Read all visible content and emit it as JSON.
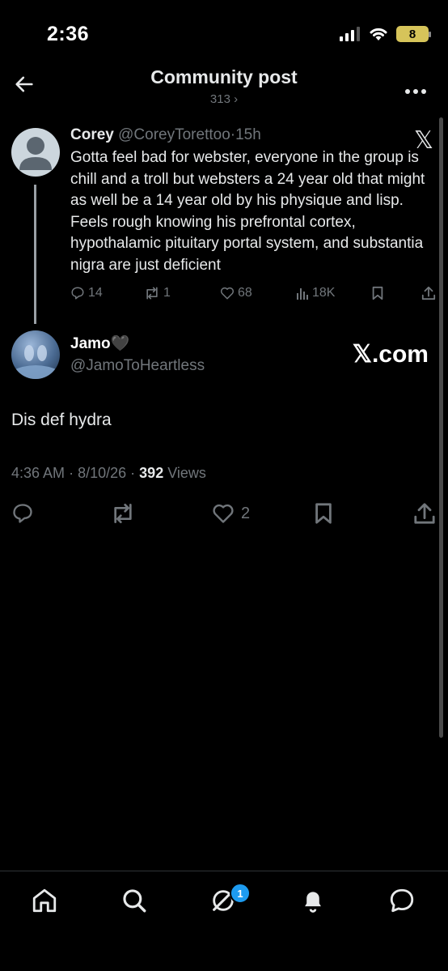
{
  "status": {
    "time": "2:36",
    "battery": "8"
  },
  "header": {
    "title": "Community post",
    "subtitle": "313 ›"
  },
  "quoted": {
    "name": "Corey",
    "handle": "@CoreyTorettoo",
    "sep": "·",
    "age": "15h",
    "text": "Gotta feel bad for webster, everyone in the group is chill and a troll but websters a 24 year old that might as well be a 14 year old by his physique and lisp. Feels rough knowing his prefrontal cortex, hypothalamic pituitary portal system, and substantia nigra are just deficient",
    "replies": "14",
    "reposts": "1",
    "likes": "68",
    "views": "18K",
    "logo": "𝕏"
  },
  "post": {
    "name": "Jamo🖤",
    "handle": "@JamoToHeartless",
    "xcom": "𝕏.com",
    "text": "Dis def hydra",
    "time": "4:36 AM",
    "sep1": "·",
    "date": "8/10/26",
    "sep2": "·",
    "views_count": "392",
    "views_label": "Views",
    "likes": "2"
  },
  "nav": {
    "badge": "1"
  },
  "icons": [
    "back-arrow-icon",
    "more-icon",
    "reply-icon",
    "repost-icon",
    "like-icon",
    "views-icon",
    "bookmark-icon",
    "share-icon",
    "home-icon",
    "search-icon",
    "grok-icon",
    "notifications-icon",
    "messages-icon"
  ]
}
